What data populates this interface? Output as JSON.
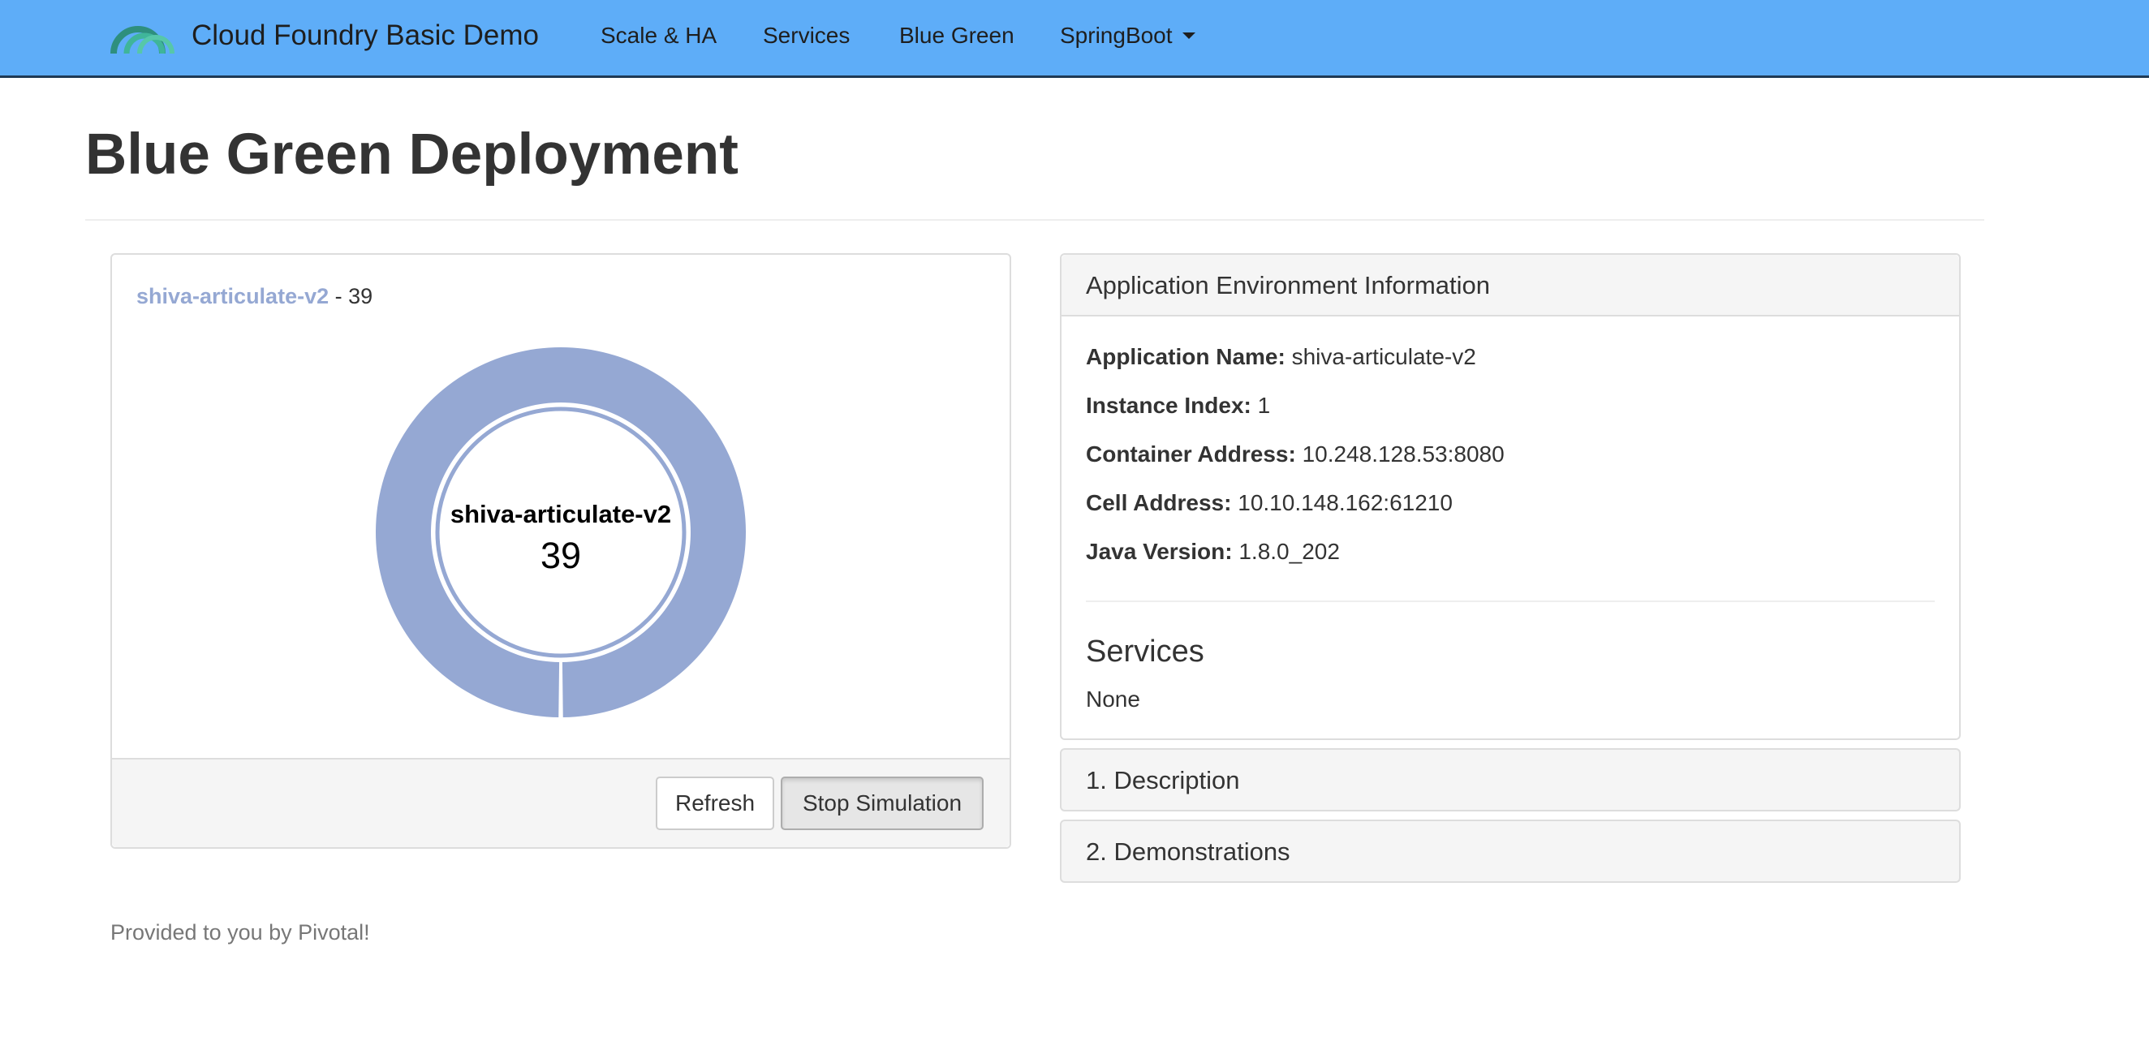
{
  "navbar": {
    "brand": "Cloud Foundry Basic Demo",
    "logo_icon": "cloud-foundry-logo-icon",
    "items": [
      {
        "label": "Scale & HA"
      },
      {
        "label": "Services"
      },
      {
        "label": "Blue Green"
      },
      {
        "label": "SpringBoot",
        "dropdown": true
      }
    ]
  },
  "page": {
    "title": "Blue Green Deployment"
  },
  "chart_panel": {
    "app_name": "shiva-articulate-v2",
    "separator": " - ",
    "count": "39",
    "center_name": "shiva-articulate-v2",
    "center_value": "39",
    "refresh_label": "Refresh",
    "stop_label": "Stop Simulation"
  },
  "chart_data": {
    "type": "pie",
    "series": [
      {
        "name": "shiva-articulate-v2",
        "values": [
          39
        ]
      }
    ],
    "categories": [
      "shiva-articulate-v2"
    ],
    "colors": [
      "#95a8d3"
    ]
  },
  "env_panel": {
    "heading": "Application Environment Information",
    "rows": [
      {
        "label": "Application Name:",
        "value": "shiva-articulate-v2"
      },
      {
        "label": "Instance Index:",
        "value": "1"
      },
      {
        "label": "Container Address:",
        "value": "10.248.128.53:8080"
      },
      {
        "label": "Cell Address:",
        "value": "10.10.148.162:61210"
      },
      {
        "label": "Java Version:",
        "value": "1.8.0_202"
      }
    ],
    "services_title": "Services",
    "services_value": "None"
  },
  "accordion": [
    {
      "label": "1. Description"
    },
    {
      "label": "2. Demonstrations"
    }
  ],
  "footer": {
    "text": "Provided to you by Pivotal!"
  },
  "colors": {
    "navbar": "#5eadf8",
    "donut": "#95a8d3",
    "link": "#95a8d3"
  }
}
